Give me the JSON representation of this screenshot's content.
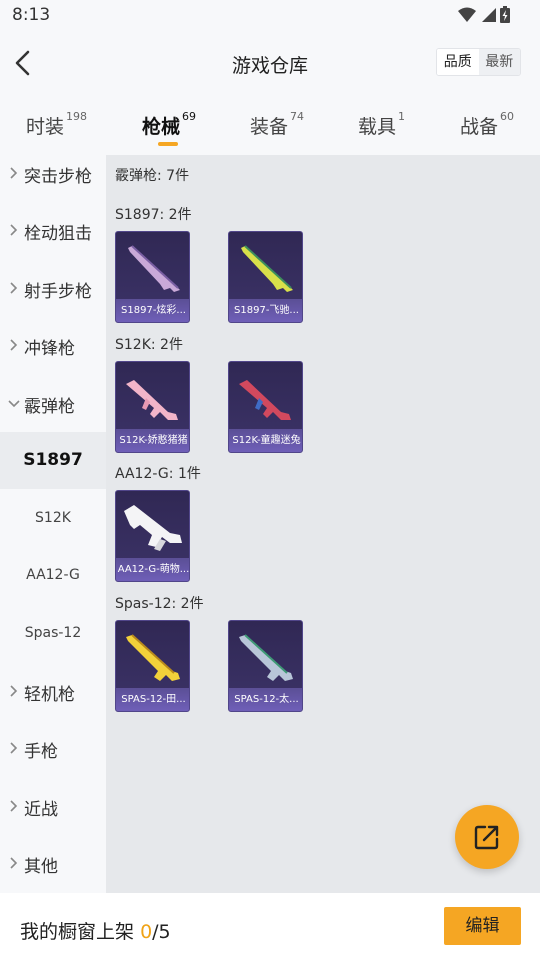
{
  "status": {
    "time": "8:13"
  },
  "header": {
    "title": "游戏仓库",
    "sort_quality": "品质",
    "sort_newest": "最新"
  },
  "tabs": [
    {
      "label": "时装",
      "count": "198"
    },
    {
      "label": "枪械",
      "count": "69"
    },
    {
      "label": "装备",
      "count": "74"
    },
    {
      "label": "载具",
      "count": "1"
    },
    {
      "label": "战备",
      "count": "60"
    }
  ],
  "sidebar": {
    "categories": [
      "突击步枪",
      "栓动狙击",
      "射手步枪",
      "冲锋枪",
      "霰弹枪",
      "轻机枪",
      "手枪",
      "近战",
      "其他"
    ],
    "subitems": [
      "S1897",
      "S12K",
      "AA12-G",
      "Spas-12"
    ]
  },
  "content": {
    "header": "霰弹枪: 7件",
    "groups": [
      {
        "title": "S1897: 2件",
        "items": [
          "S1897-炫彩...",
          "S1897-飞驰..."
        ]
      },
      {
        "title": "S12K: 2件",
        "items": [
          "S12K-娇憨猪猪",
          "S12K-童趣迷兔"
        ]
      },
      {
        "title": "AA12-G: 1件",
        "items": [
          "AA12-G-萌物..."
        ]
      },
      {
        "title": "Spas-12: 2件",
        "items": [
          "SPAS-12-田...",
          "SPAS-12-太..."
        ]
      }
    ]
  },
  "bottom": {
    "label": "我的橱窗上架",
    "count": "0",
    "total": "/5",
    "edit": "编辑"
  },
  "colors": {
    "accent": "#f5a623",
    "card_bg": "#302854",
    "card_caption": "#6f5fb8"
  },
  "icons": [
    "back-arrow-icon",
    "chevron-right-icon",
    "chevron-down-icon",
    "share-export-icon",
    "wifi-icon",
    "signal-icon",
    "battery-icon"
  ]
}
